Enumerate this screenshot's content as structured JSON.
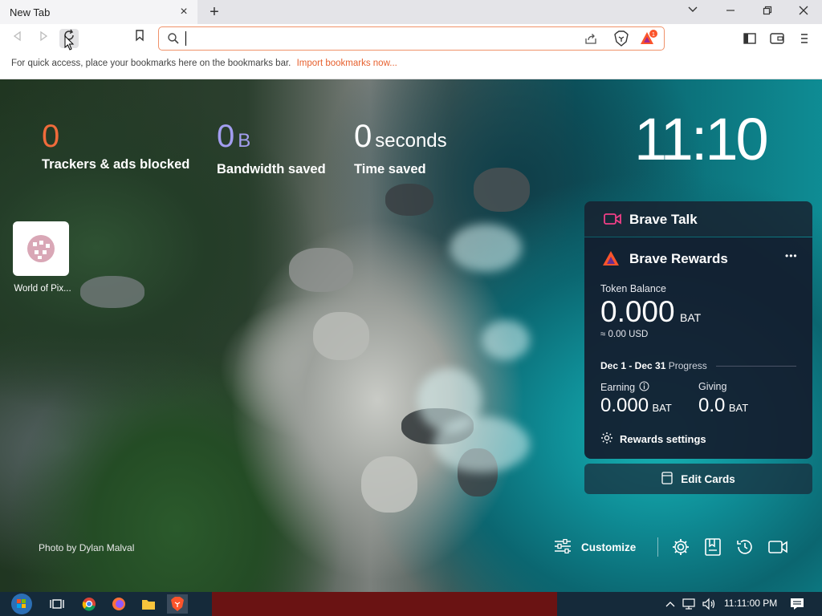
{
  "tab": {
    "title": "New Tab",
    "close": "×",
    "new": "+"
  },
  "window": {
    "minimize": "—",
    "restore": "❐",
    "close": "✕",
    "tablist": "⌄"
  },
  "omnibox": {
    "value": ""
  },
  "bookmarks_bar": {
    "hint": "For quick access, place your bookmarks here on the bookmarks bar.",
    "import_link": "Import bookmarks now..."
  },
  "rewards_badge": "1",
  "stats": [
    {
      "value": "0",
      "unit": "",
      "label": "Trackers & ads blocked",
      "color": "#f06b3b"
    },
    {
      "value": "0",
      "unit": "B",
      "label": "Bandwidth saved",
      "color": "#a39ef0"
    },
    {
      "value": "0",
      "unit": "seconds",
      "label": "Time saved",
      "color": "#ffffff"
    }
  ],
  "clock": "11:10",
  "top_sites": [
    {
      "label": "World of Pix..."
    }
  ],
  "brave_talk": {
    "title": "Brave Talk"
  },
  "brave_rewards": {
    "title": "Brave Rewards",
    "more": "•••",
    "token_balance_label": "Token Balance",
    "balance": "0.000",
    "balance_unit": "BAT",
    "usd": "≈ 0.00 USD",
    "period": "Dec 1 - Dec 31",
    "progress_label": "Progress",
    "earning_label": "Earning",
    "earning_value": "0.000",
    "earning_unit": "BAT",
    "giving_label": "Giving",
    "giving_value": "0.0",
    "giving_unit": "BAT",
    "settings": "Rewards settings"
  },
  "edit_cards": "Edit Cards",
  "photo_credit": "Photo by Dylan Malval",
  "customize": "Customize",
  "taskbar": {
    "time": "11:11:00 PM"
  },
  "colors": {
    "accent": "#e7612f",
    "brave_orange": "#fb542b",
    "card_bg": "#141c2e"
  }
}
